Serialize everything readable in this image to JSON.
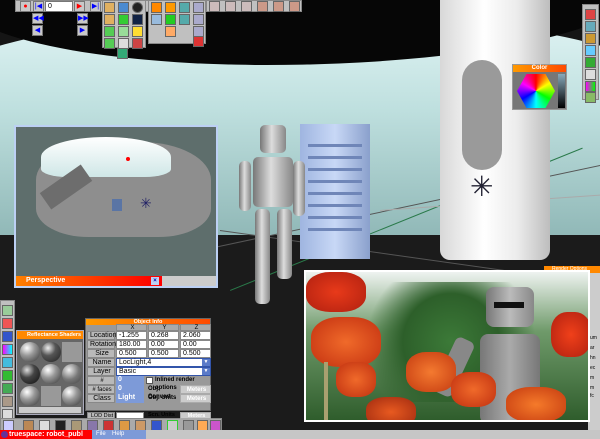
{
  "toolbar": {
    "frame_value": "0"
  },
  "perspective": {
    "title": "Perspective"
  },
  "color_panel": {
    "title": "Color"
  },
  "reflectance": {
    "title": "Reflectance Shaders"
  },
  "object_info": {
    "title": "Object Info",
    "columns": [
      "X",
      "Y",
      "Z"
    ],
    "rows": [
      {
        "label": "Location",
        "values": [
          "-1.255",
          "0.268",
          "2.060"
        ]
      },
      {
        "label": "Rotation",
        "values": [
          "180.00",
          "0.00",
          "0.00"
        ]
      },
      {
        "label": "Size",
        "values": [
          "0.500",
          "0.500",
          "0.500"
        ]
      }
    ],
    "name_label": "Name",
    "name_value": "LocLight,4",
    "layer_label": "Layer",
    "layer_value": "Basic",
    "vertices_label": "# vertices",
    "vertices_value": "0",
    "faces_label": "# faces",
    "faces_value": "0",
    "class_label": "Class",
    "class_value": "Light",
    "lod_label": "LOD Dist",
    "lod_value": "",
    "inlined_label": "Inlined render options",
    "convert_label": "Obj. Convert",
    "convert_value": "Meters",
    "obj_units_label": "Obj. Units",
    "obj_units_value": "Meters",
    "scn_units_label": "Scn. Units",
    "scn_units_value": "Meters"
  },
  "render_window": {
    "title": "Render Options"
  },
  "side_panel": {
    "items": [
      "um",
      "ar",
      "hn",
      "ec",
      "m",
      "m",
      "fc"
    ]
  },
  "taskbar": {
    "app": "truespace: robot_publ",
    "menu": [
      "File",
      "Help"
    ]
  },
  "colors": {
    "accent": "#ff6a00",
    "title_blue": "#7d9ad8",
    "taskbar_red": "#ff0000"
  }
}
